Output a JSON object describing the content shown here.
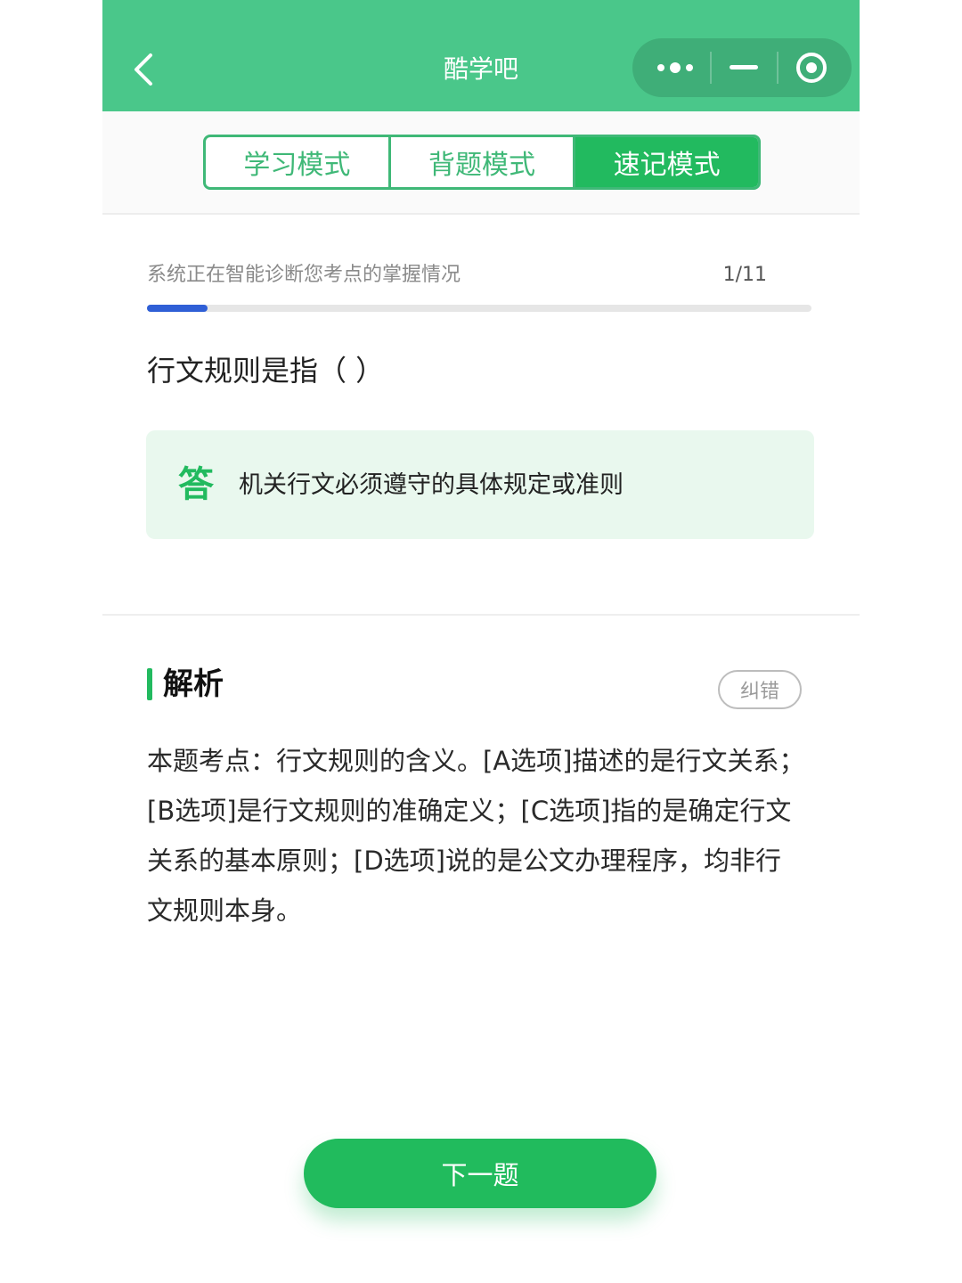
{
  "header": {
    "title": "酷学吧",
    "back_icon": "chevron-left-icon",
    "menu_icon": "more-dots-icon",
    "minimize_icon": "minus-icon",
    "close_icon": "target-circle-icon",
    "color": "#4ac78a"
  },
  "tabs": [
    {
      "label": "学习模式",
      "active": false
    },
    {
      "label": "背题模式",
      "active": false
    },
    {
      "label": "速记模式",
      "active": true
    }
  ],
  "progress": {
    "status_text": "系统正在智能诊断您考点的掌握情况",
    "count_text": "1/11",
    "current": 1,
    "total": 11,
    "bar_color": "#2f5fd6"
  },
  "question": {
    "text": "行文规则是指（    ）"
  },
  "answer": {
    "mark": "答",
    "text": "机关行文必须遵守的具体规定或准则"
  },
  "analysis": {
    "title": "解析",
    "report_label": "纠错",
    "body": "本题考点：行文规则的含义。[A选项]描述的是行文关系；[B选项]是行文规则的准确定义；[C选项]指的是确定行文关系的基本原则；[D选项]说的是公文办理程序，均非行文规则本身。"
  },
  "next_button": {
    "label": "下一题",
    "color": "#21bb5d"
  }
}
